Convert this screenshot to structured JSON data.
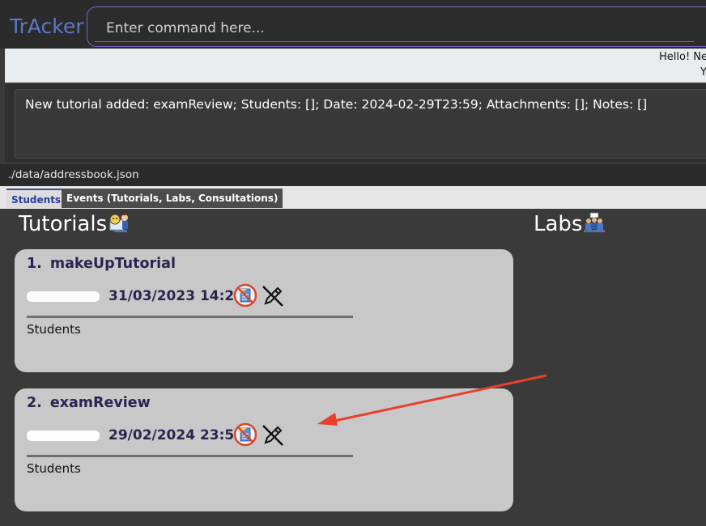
{
  "app": {
    "title": "TrAcker"
  },
  "command": {
    "placeholder": "Enter command here..."
  },
  "greeting": {
    "line1": "Hello! Ne",
    "line2": "Yo"
  },
  "result": {
    "text": "New tutorial added: examReview; Students: []; Date: 2024-02-29T23:59; Attachments: []; Notes: []"
  },
  "status": {
    "path": "./data/addressbook.json"
  },
  "tabs": [
    {
      "label": "Students"
    },
    {
      "label": "Events (Tutorials, Labs, Consultations)"
    }
  ],
  "sections": {
    "tutorials_title": "Tutorials",
    "labs_title": "Labs"
  },
  "tutorials": [
    {
      "index": "1.",
      "name": "makeUpTutorial",
      "date": "31/03/2023 14:23",
      "students_label": "Students",
      "progress": 0
    },
    {
      "index": "2.",
      "name": "examReview",
      "date": "29/02/2024 23:59",
      "students_label": "Students",
      "progress": 0
    }
  ],
  "icons": {
    "tutorials": "teacher-icon",
    "labs": "lab-group-icon",
    "attachment": "no-attachment-icon",
    "edit": "no-edit-icon",
    "annotation": "red-arrow-annotation"
  },
  "colors": {
    "accent": "#5c79c9",
    "card_bg": "#c8c8c8",
    "card_text": "#2a2550",
    "arrow": "#e8402a"
  }
}
